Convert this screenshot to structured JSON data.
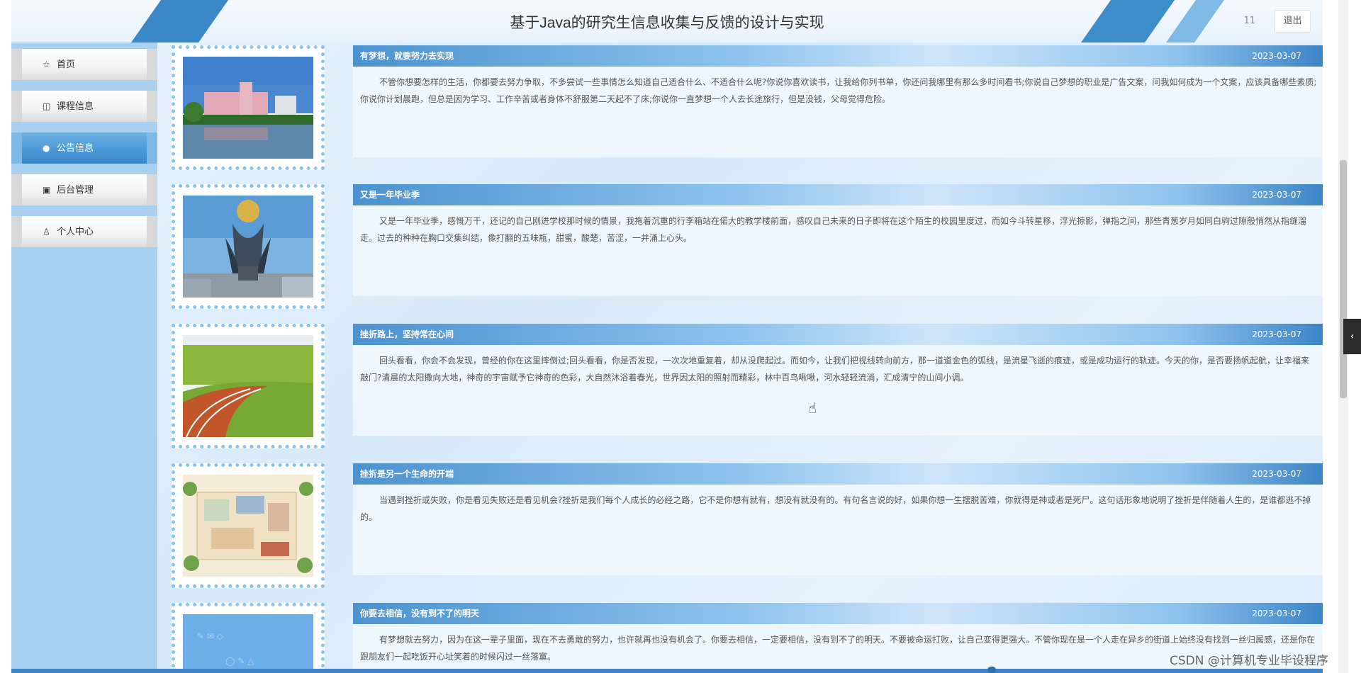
{
  "header": {
    "title": "基于Java的研究生信息收集与反馈的设计与实现",
    "user": "11",
    "logout_label": "退出"
  },
  "sidebar": {
    "items": [
      {
        "label": "首页",
        "icon": "star-icon",
        "active": false
      },
      {
        "label": "课程信息",
        "icon": "bag-icon",
        "active": false
      },
      {
        "label": "公告信息",
        "icon": "info-icon",
        "active": true
      },
      {
        "label": "后台管理",
        "icon": "briefcase-icon",
        "active": false
      },
      {
        "label": "个人中心",
        "icon": "user-icon",
        "active": false
      }
    ]
  },
  "notices": [
    {
      "title": "有梦想，就要努力去实现",
      "date": "2023-03-07",
      "image": "campus-building-lake",
      "content": "不管你想要怎样的生活，你都要去努力争取，不多尝试一些事情怎么知道自己适合什么、不适合什么呢?你说你喜欢读书，让我给你列书单，你还问我哪里有那么多时间看书;你说自己梦想的职业是广告文案，问我如何成为一个文案，应该具备哪些素质;你说你计划晨跑，但总是因为学习、工作辛苦或者身体不舒服第二天起不了床;你说你一直梦想一个人去长途旅行，但是没钱，父母觉得危险。"
    },
    {
      "title": "又是一年毕业季",
      "date": "2023-03-07",
      "image": "campus-globe-sculpture",
      "content": "又是一年毕业季，感慨万千，还记的自己刚进学校那时候的情景，我拖着沉重的行李箱站在偌大的教学楼前面，感叹自己未来的日子即将在这个陌生的校园里度过，而如今斗转星移，浮光掠影，弹指之间，那些青葱岁月如同白驹过隙般悄然从指缝溜走。过去的种种在胸口交集纠结，像打翻的五味瓶，甜蜜，酸楚，苦涩，一并涌上心头。"
    },
    {
      "title": "挫折路上，坚持常在心间",
      "date": "2023-03-07",
      "image": "running-track-trees",
      "content": "回头看看，你会不会发现，曾经的你在这里摔倒过;回头看看，你是否发现，一次次地重复着，却从没爬起过。而如今，让我们把视线转向前方，那一道道金色的弧线，是流星飞逝的痕迹，或是成功运行的轨迹。今天的你，是否要扬帆起航，让幸福来敲门?清晨的太阳撒向大地，神奇的宇宙赋予它神奇的色彩，大自然沐浴着春光，世界因太阳的照射而精彩，林中百鸟啾啾，河水轻轻流淌，汇成清宁的山间小调。"
    },
    {
      "title": "挫折是另一个生命的开端",
      "date": "2023-03-07",
      "image": "campus-map-illustration",
      "content": "当遇到挫折或失败，你是看见失败还是看见机会?挫折是我们每个人成长的必经之路，它不是你想有就有，想没有就没有的。有句名言说的好，如果你想一生摆脱苦难，你就得是神或者是死尸。这句话形象地说明了挫折是伴随着人生的，是谁都逃不掉的。"
    },
    {
      "title": "你要去相信，没有到不了的明天",
      "date": "2023-03-07",
      "image": "school-doodle-pattern",
      "content": "有梦想就去努力，因为在这一辈子里面，现在不去勇敢的努力，也许就再也没有机会了。你要去相信，一定要相信，没有到不了的明天。不要被命运打败，让自己变得更强大。不管你现在是一个人走在异乡的街道上始终没有找到一丝归属感，还是你在跟朋友们一起吃饭开心址笑着的时候闪过一丝落寞。"
    }
  ],
  "misc": {
    "watermark": "CSDN @计算机专业毕设程序",
    "side_tab_icon": "‹"
  },
  "colors": {
    "accent": "#3c84c6",
    "sidebar_bg": "#a9d0ef",
    "active_nav": "#4a97d6"
  }
}
